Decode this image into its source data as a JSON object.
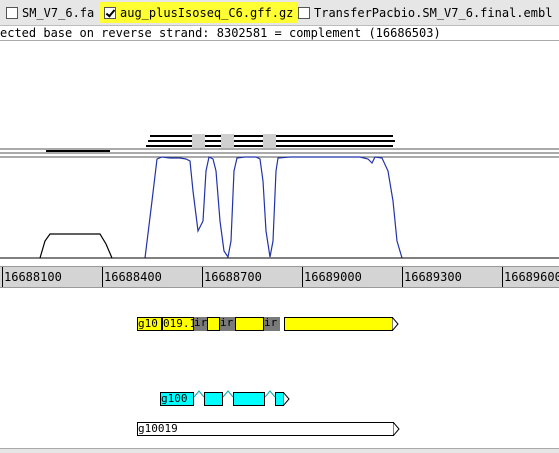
{
  "tabs": [
    {
      "label": "SM_V7_6.fa",
      "checked": false
    },
    {
      "label": "aug_plusIsoseq_C6.gff.gz",
      "checked": true,
      "active": true
    },
    {
      "label": "TransferPacbio.SM_V7_6.final.embl",
      "checked": false
    }
  ],
  "status_text": "ected base on reverse strand: 8302581  = complement (16686503)",
  "ruler": {
    "ticks": [
      "16688100",
      "16688400",
      "16688700",
      "16689000",
      "16689300",
      "16689600"
    ]
  },
  "features": {
    "yellow_label_1": "g10",
    "yellow_label_2": "019.1",
    "yellow_label_3": "ir",
    "yellow_label_4": "ir",
    "yellow_label_5": "ir",
    "cyan_label": "g100",
    "gene_label": "g10019"
  },
  "colors": {
    "tab_active": "#ffff33",
    "graph_line": "#2233aa",
    "yellow_feature": "#ffff00",
    "cyan_feature": "#00ffff",
    "ruler_bg": "#d4d4d4"
  }
}
